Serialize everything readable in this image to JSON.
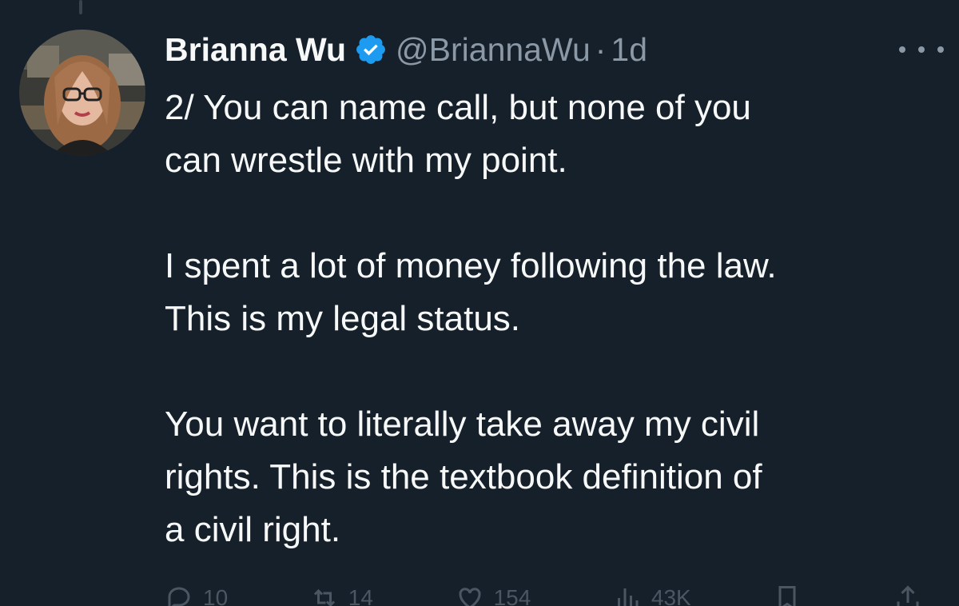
{
  "tweet": {
    "display_name": "Brianna Wu",
    "verified": true,
    "handle": "@BriannaWu",
    "separator": "·",
    "time": "1d",
    "text": {
      "p1_line1": "2/ You can name call, but none of you",
      "p1_line2": "can wrestle with my point.",
      "p2_line1": "I spent a lot of money following the law.",
      "p2_line2": "This is my legal status.",
      "p3_line1": "You want to literally take away my civil",
      "p3_line2": "rights. This is the textbook definition of",
      "p3_line3": "a civil right."
    },
    "actions": {
      "replies": "10",
      "retweets": "14",
      "likes": "154",
      "views": "43K"
    }
  },
  "colors": {
    "background": "#15202b",
    "text_primary": "#f7f9f9",
    "text_secondary": "#8b98a5",
    "verified_blue": "#1d9bf0"
  },
  "icons": {
    "verified": "verified-badge-icon",
    "more": "more-options-icon",
    "reply": "reply-icon",
    "retweet": "retweet-icon",
    "like": "heart-icon",
    "views": "views-icon",
    "bookmark": "bookmark-icon",
    "share": "share-icon"
  }
}
